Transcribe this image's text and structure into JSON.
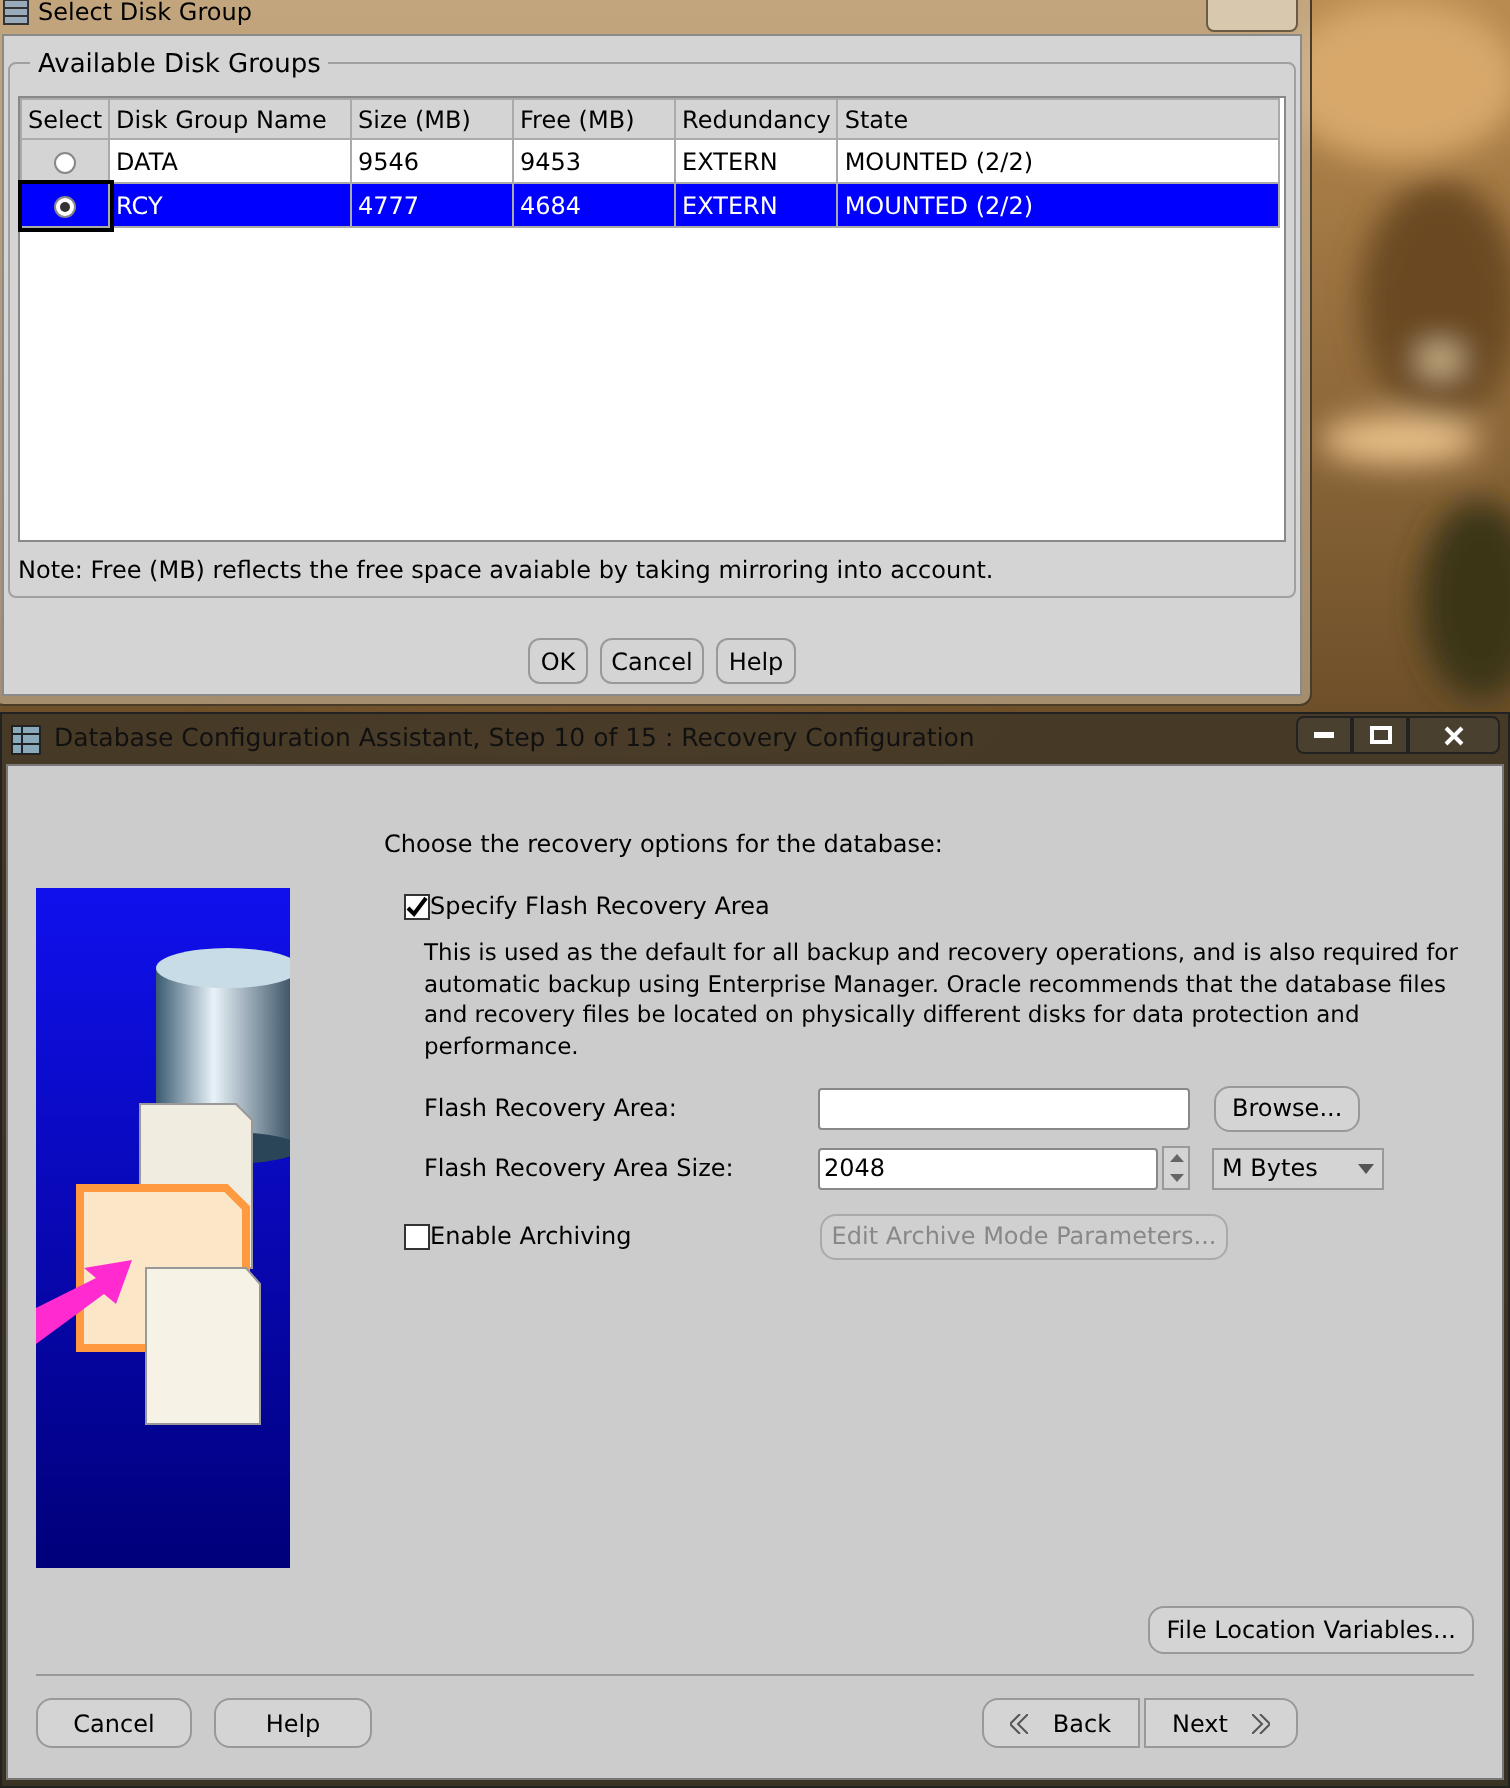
{
  "disk_dialog": {
    "title": "Select Disk Group",
    "group_label": "Available Disk Groups",
    "columns": [
      "Select",
      "Disk Group Name",
      "Size (MB)",
      "Free (MB)",
      "Redundancy",
      "State"
    ],
    "rows": [
      {
        "selected": false,
        "cells": [
          "",
          "DATA",
          "9546",
          "9453",
          "EXTERN",
          "MOUNTED (2/2)"
        ]
      },
      {
        "selected": true,
        "cells": [
          "",
          "RCY",
          "4777",
          "4684",
          "EXTERN",
          "MOUNTED (2/2)"
        ]
      }
    ],
    "note": "Note: Free (MB) reflects the free space avaiable by taking mirroring into account.",
    "buttons": [
      "OK",
      "Cancel",
      "Help"
    ]
  },
  "main_window": {
    "title": "Database Configuration Assistant, Step 10 of 15 : Recovery Configuration",
    "intro": "Choose the recovery options for the database:",
    "flash": {
      "label": "Specify Flash Recovery Area",
      "checked": true,
      "description": "This is used as the default for all backup and recovery operations, and is also required for automatic backup using Enterprise Manager. Oracle recommends that the database files and recovery files be located on physically different disks for data protection and performance.",
      "area_label": "Flash Recovery Area:",
      "browse": "Browse...",
      "size_label": "Flash Recovery Area Size:",
      "size_value": "2048",
      "unit": "M Bytes"
    },
    "archiving": {
      "label": "Enable Archiving",
      "checked": false,
      "button": "Edit Archive Mode Parameters...",
      "button_disabled": true
    },
    "file_location_button": "File Location Variables...",
    "footer": {
      "cancel": "Cancel",
      "help": "Help",
      "back": "Back",
      "next": "Next"
    }
  }
}
